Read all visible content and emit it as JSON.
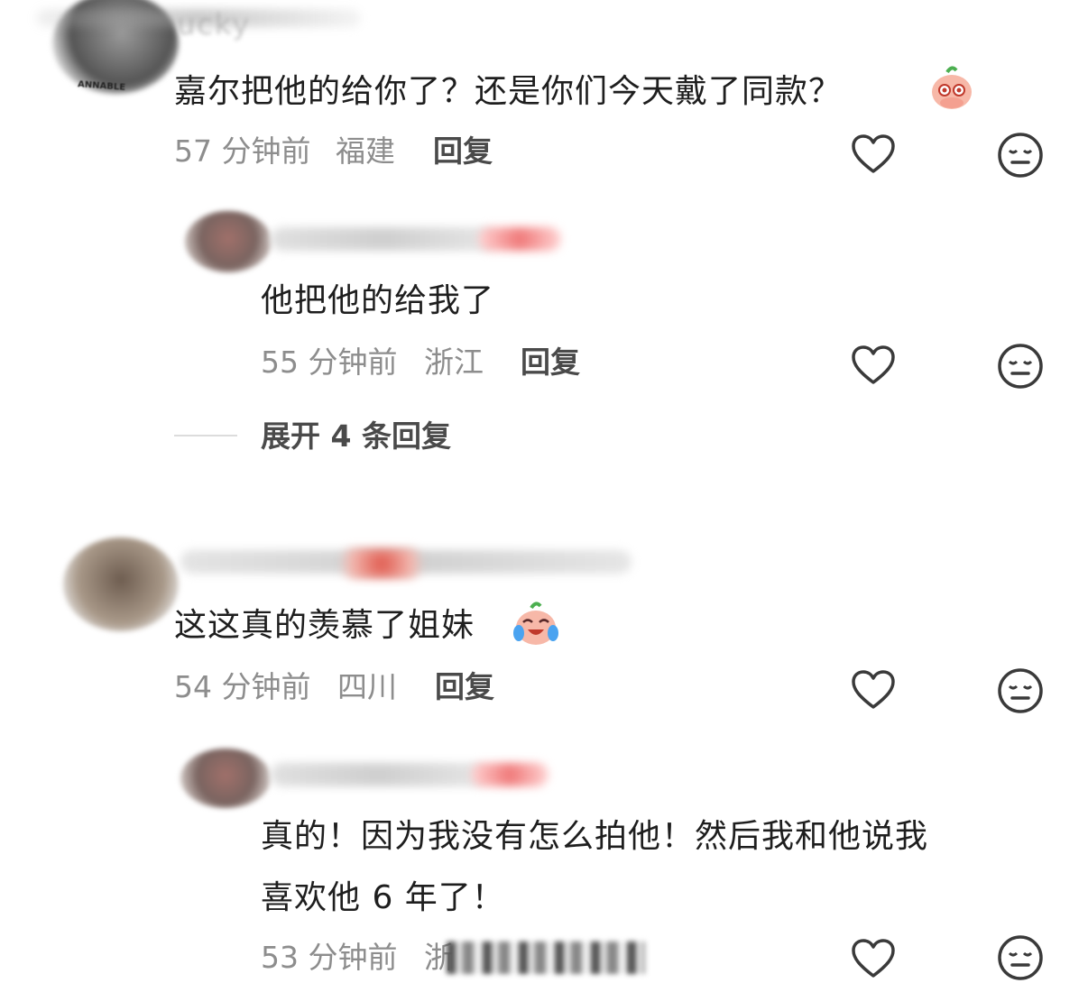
{
  "comments": [
    {
      "user_partial": "ucky",
      "avatar_text": "ANNABLE",
      "text": "嘉尔把他的给你了？还是你们今天戴了同款？",
      "emoji": "peach-shy-emoji",
      "time": "57 分钟前",
      "location": "福建",
      "reply_label": "回复"
    },
    {
      "text": "他把他的给我了",
      "time": "55 分钟前",
      "location": "浙江",
      "reply_label": "回复"
    },
    {
      "expand_label": "展开 4 条回复"
    },
    {
      "text": "这这真的羡慕了姐妹",
      "emoji": "peach-laugh-cry-emoji",
      "time": "54 分钟前",
      "location": "四川",
      "reply_label": "回复"
    },
    {
      "text_line1": "真的！因为我没有怎么拍他！然后我和他说我",
      "text_line2": "喜欢他 6 年了！",
      "time": "53 分钟前",
      "location_partial": "浙"
    }
  ],
  "icons": {
    "like": "heart-outline-icon",
    "dislike": "meh-face-icon"
  },
  "colors": {
    "text": "#1e1e1e",
    "meta": "#8d8d8d",
    "reply": "#4a4a4a",
    "icon": "#3a3a3a"
  }
}
